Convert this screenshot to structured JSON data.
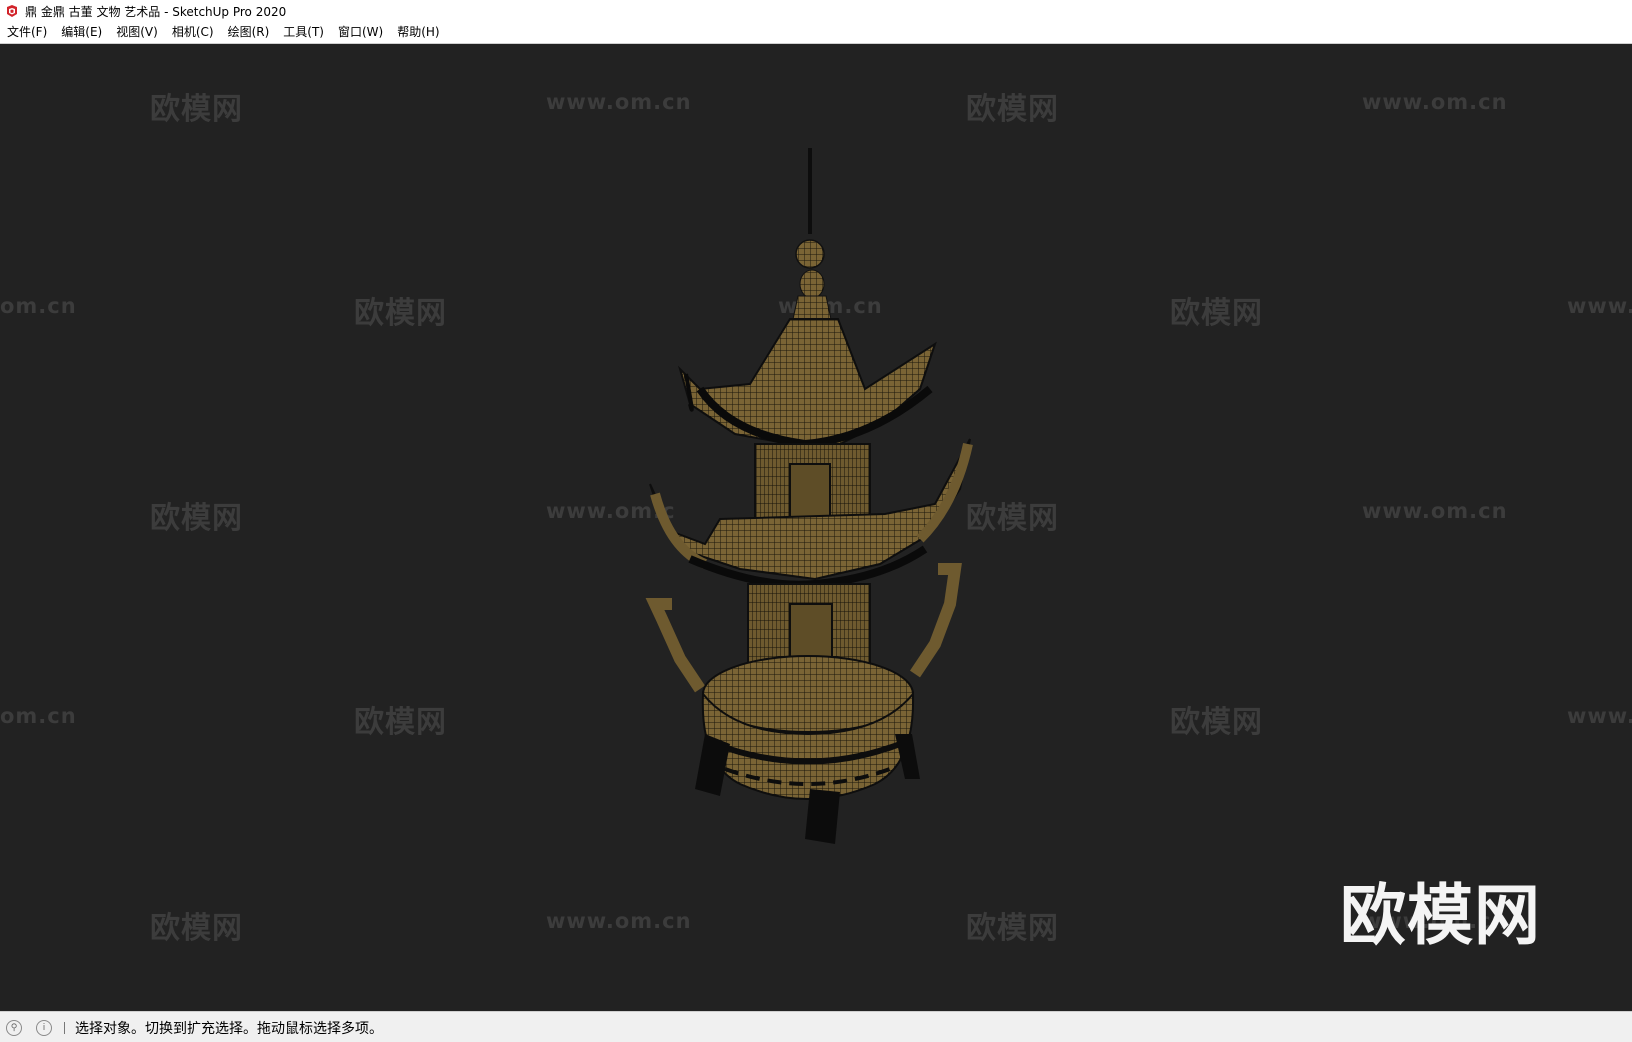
{
  "window": {
    "title": "鼎 金鼎 古董 文物 艺术品 - SketchUp Pro 2020",
    "icon": "sketchup-logo-icon"
  },
  "menubar": {
    "items": [
      {
        "label": "文件(F)"
      },
      {
        "label": "编辑(E)"
      },
      {
        "label": "视图(V)"
      },
      {
        "label": "相机(C)"
      },
      {
        "label": "绘图(R)"
      },
      {
        "label": "工具(T)"
      },
      {
        "label": "窗口(W)"
      },
      {
        "label": "帮助(H)"
      }
    ]
  },
  "viewport": {
    "background": "#222222",
    "model_color": "#7a6435",
    "watermark_logo": "欧模网",
    "watermark_url": "www.om.cn",
    "watermark_url_partial": "om.cn",
    "watermark_www_partial": "www.",
    "watermark_url_left_partial": "www.om.c",
    "watermark_url_mid_partial": "w.om.cn",
    "big_watermark": "欧模网"
  },
  "statusbar": {
    "icons": [
      "geo-location-icon",
      "info-icon"
    ],
    "message": "选择对象。切换到扩充选择。拖动鼠标选择多项。"
  }
}
